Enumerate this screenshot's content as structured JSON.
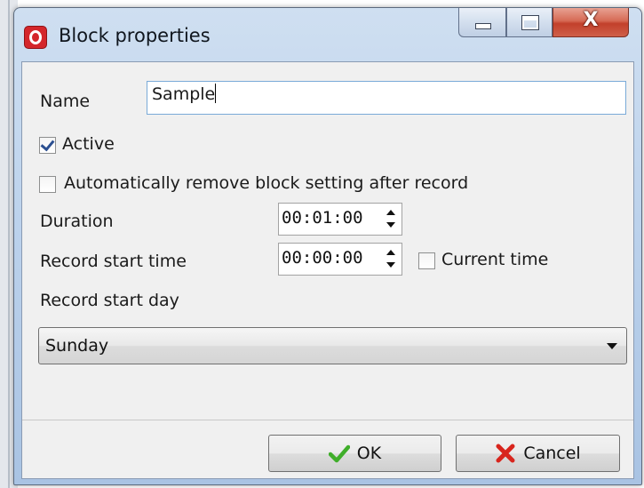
{
  "window": {
    "title": "Block properties",
    "app_icon": "app-logo-icon",
    "controls": {
      "minimize_icon": "minimize-icon",
      "maximize_icon": "maximize-icon",
      "close_glyph": "X"
    }
  },
  "form": {
    "name_label": "Name",
    "name_value": "Sample",
    "active_label": "Active",
    "active_checked": true,
    "auto_remove_label": "Automatically remove block setting after record",
    "auto_remove_checked": false,
    "duration_label": "Duration",
    "duration_value": "00:01:00",
    "record_start_time_label": "Record start time",
    "record_start_time_value": "00:00:00",
    "current_time_label": "Current time",
    "current_time_checked": false,
    "record_start_day_label": "Record start day",
    "record_start_day_value": "Sunday"
  },
  "buttons": {
    "ok_label": "OK",
    "ok_icon": "checkmark-icon",
    "cancel_label": "Cancel",
    "cancel_icon": "cross-icon"
  },
  "colors": {
    "ok_check": "#3fae2a",
    "cancel_cross": "#d8251d",
    "app_icon": "#d4262b",
    "close_button": "#c8452f"
  }
}
